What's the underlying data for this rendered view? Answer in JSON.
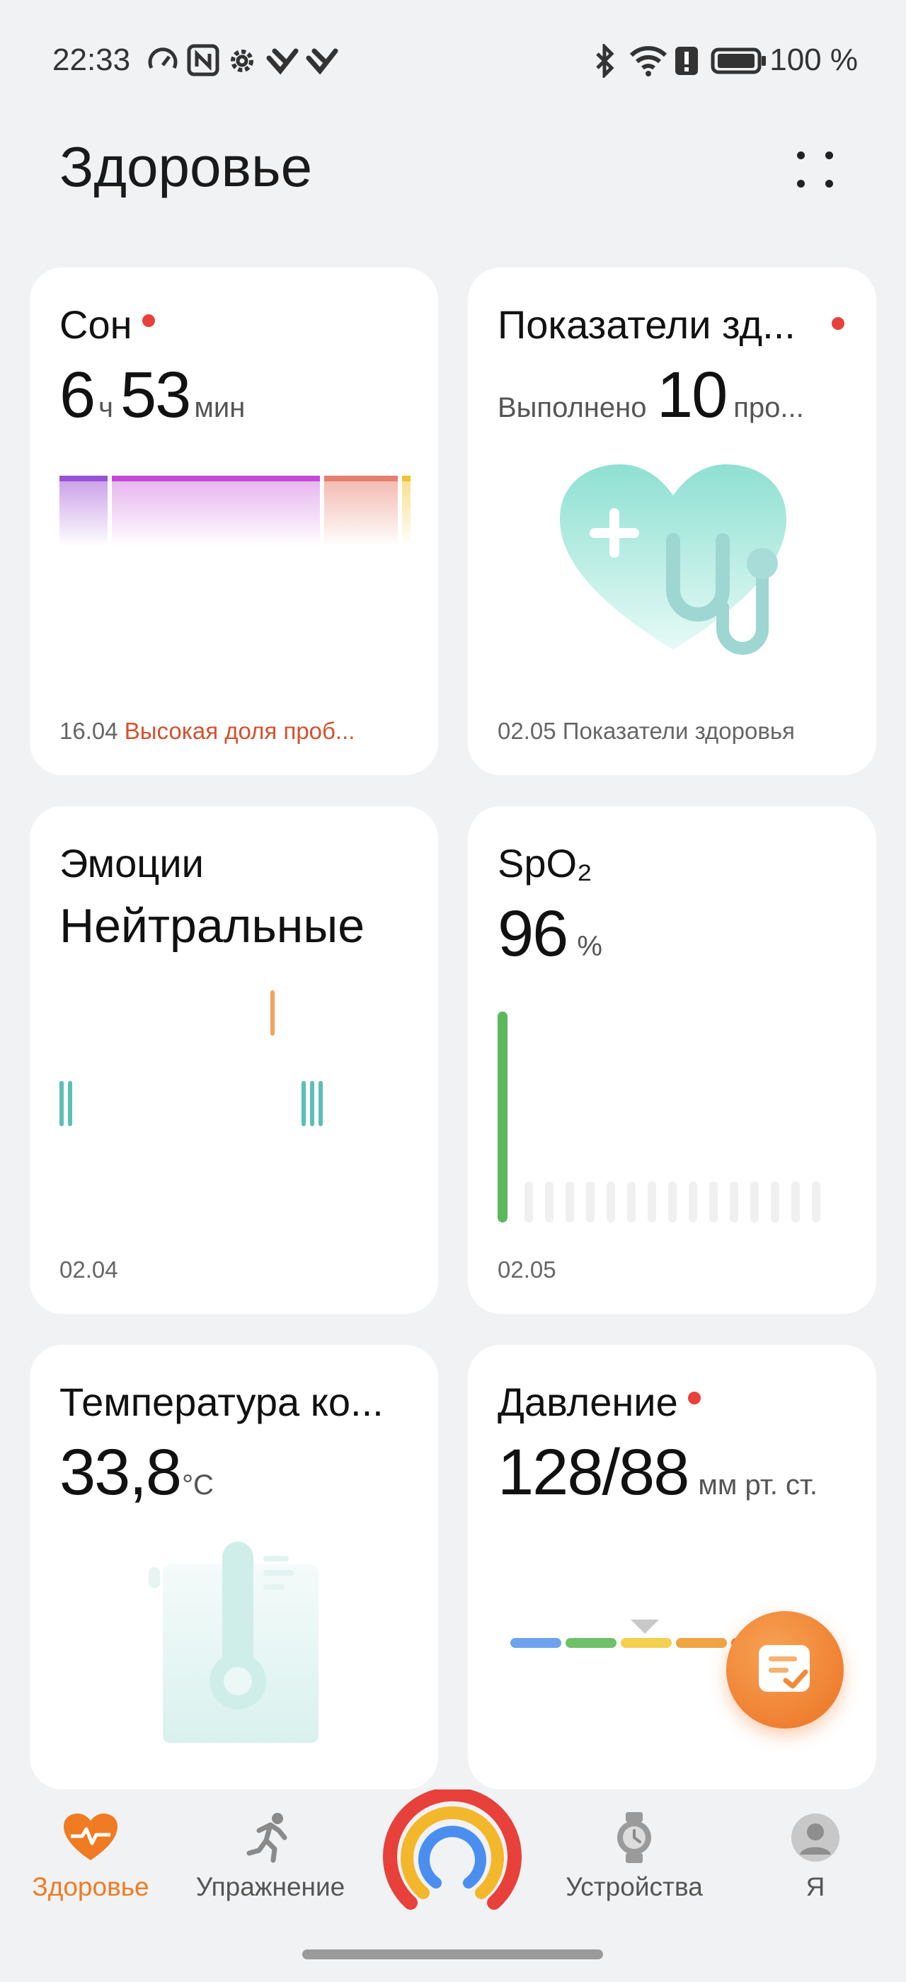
{
  "status_bar": {
    "time": "22:33",
    "battery": "100 %"
  },
  "header": {
    "title": "Здоровье"
  },
  "cards": {
    "sleep": {
      "title": "Сон",
      "hours": "6",
      "hours_unit": "ч",
      "minutes": "53",
      "minutes_unit": "мин",
      "date": "16.04",
      "note": "Высокая доля проб..."
    },
    "health": {
      "title": "Показатели зд...",
      "done_label": "Выполнено",
      "count": "10",
      "count_suffix": "про...",
      "date": "02.05",
      "footer": "Показатели здоровья"
    },
    "emotions": {
      "title": "Эмоции",
      "value": "Нейтральные",
      "date": "02.04"
    },
    "spo2": {
      "title": "SpO₂",
      "value": "96",
      "unit": "%",
      "date": "02.05",
      "latest_level": 0.96
    },
    "temperature": {
      "title": "Температура ко...",
      "value": "33,8",
      "unit": "°C"
    },
    "pressure": {
      "title": "Давление",
      "value": "128/88",
      "unit": "мм рт. ст."
    }
  },
  "nav": {
    "health": "Здоровье",
    "exercise": "Упражнение",
    "devices": "Устройства",
    "me": "Я"
  },
  "colors": {
    "accent": "#f07b22",
    "red_dot": "#e8403a",
    "teal": "#5bbfb5",
    "green": "#5cb85c"
  }
}
